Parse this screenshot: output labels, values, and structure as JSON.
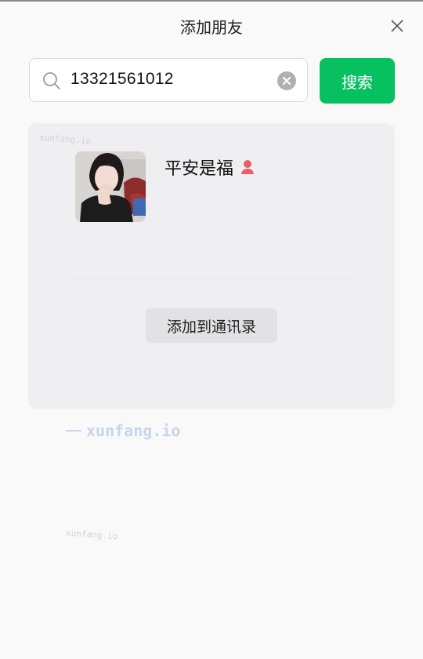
{
  "header": {
    "title": "添加朋友"
  },
  "icons": {
    "close": "close-icon",
    "search": "search-icon",
    "clear": "clear-icon",
    "gender": "female-user-icon"
  },
  "search": {
    "value": "13321561012",
    "button_label": "搜索"
  },
  "result": {
    "name": "平安是福",
    "add_label": "添加到通讯录"
  },
  "watermark": {
    "text": "xunfang.io"
  },
  "colors": {
    "accent": "#07c160",
    "gender_icon": "#e8606a"
  }
}
